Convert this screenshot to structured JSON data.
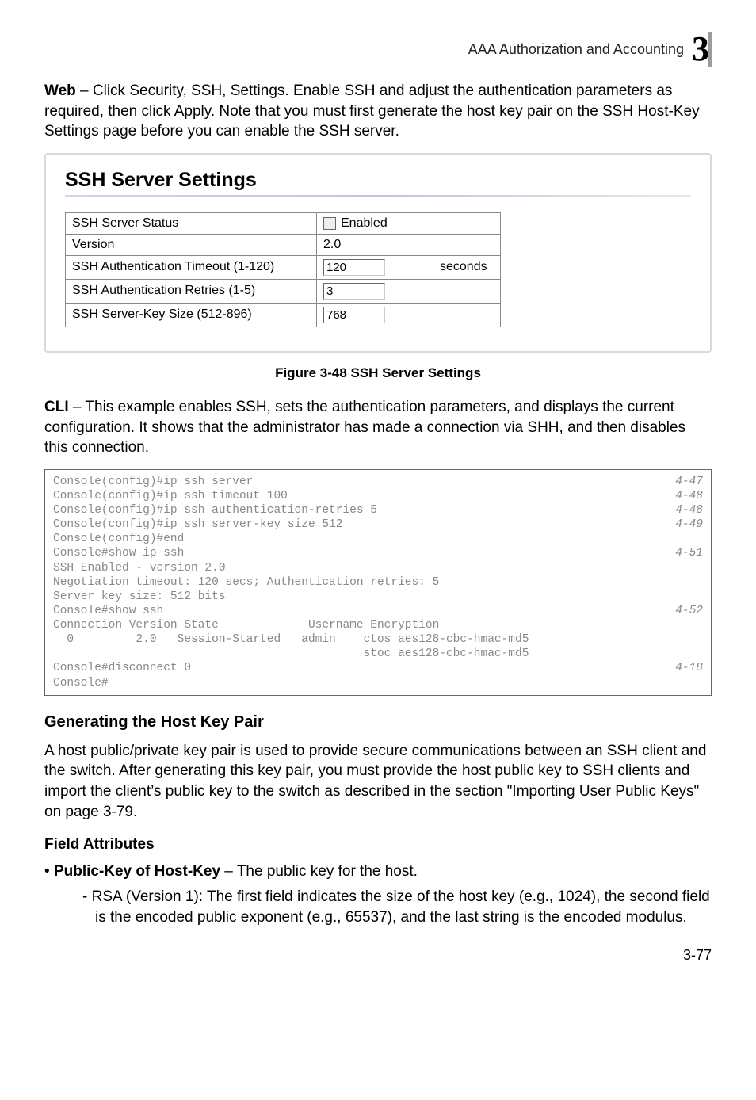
{
  "header": {
    "section_title": "AAA Authorization and Accounting",
    "chapter_number": "3"
  },
  "intro_web": {
    "lead": "Web",
    "text": " – Click Security, SSH, Settings. Enable SSH and adjust the authentication parameters as required, then click Apply. Note that you must first generate the host key pair on the SSH Host-Key Settings page before you can enable the SSH server."
  },
  "settings": {
    "title": "SSH Server Settings",
    "rows": {
      "status_label": "SSH Server Status",
      "status_enabled_label": "Enabled",
      "version_label": "Version",
      "version_value": "2.0",
      "timeout_label": "SSH Authentication Timeout (1-120)",
      "timeout_value": "120",
      "timeout_unit": "seconds",
      "retries_label": "SSH Authentication Retries (1-5)",
      "retries_value": "3",
      "keysize_label": "SSH Server-Key Size (512-896)",
      "keysize_value": "768"
    }
  },
  "figure_caption": "Figure 3-48  SSH Server Settings",
  "intro_cli": {
    "lead": "CLI",
    "text": " – This example enables SSH, sets the authentication parameters, and displays the current configuration. It shows that the administrator has made a connection via SHH, and then disables this connection."
  },
  "console_lines": [
    {
      "text": "Console(config)#ip ssh server",
      "ref": "4-47"
    },
    {
      "text": "Console(config)#ip ssh timeout 100",
      "ref": "4-48"
    },
    {
      "text": "Console(config)#ip ssh authentication-retries 5",
      "ref": "4-48"
    },
    {
      "text": "Console(config)#ip ssh server-key size 512",
      "ref": "4-49"
    },
    {
      "text": "Console(config)#end",
      "ref": ""
    },
    {
      "text": "Console#show ip ssh",
      "ref": "4-51"
    },
    {
      "text": "SSH Enabled - version 2.0",
      "ref": ""
    },
    {
      "text": "Negotiation timeout: 120 secs; Authentication retries: 5",
      "ref": ""
    },
    {
      "text": "Server key size: 512 bits",
      "ref": ""
    },
    {
      "text": "Console#show ssh",
      "ref": "4-52"
    },
    {
      "text": "Connection Version State             Username Encryption",
      "ref": ""
    },
    {
      "text": "  0         2.0   Session-Started   admin    ctos aes128-cbc-hmac-md5",
      "ref": ""
    },
    {
      "text": "                                             stoc aes128-cbc-hmac-md5",
      "ref": ""
    },
    {
      "text": "Console#disconnect 0",
      "ref": "4-18"
    },
    {
      "text": "Console#",
      "ref": ""
    }
  ],
  "hostkey": {
    "heading": "Generating the Host Key Pair",
    "para": "A host public/private key pair is used to provide secure communications between an SSH client and the switch. After generating this key pair, you must provide the host public key to SSH clients and import the client’s public key to the switch as described in the section \"Importing User Public Keys\" on page 3-79."
  },
  "field_attributes": {
    "heading": "Field Attributes",
    "bullet_lead": "Public-Key of Host-Key",
    "bullet_rest": " – The public key for the host.",
    "sub_bullet": "RSA (Version 1): The first field indicates the size of the host key (e.g., 1024), the second field is the encoded public exponent (e.g., 65537), and the last string is the encoded modulus."
  },
  "page_number": "3-77"
}
